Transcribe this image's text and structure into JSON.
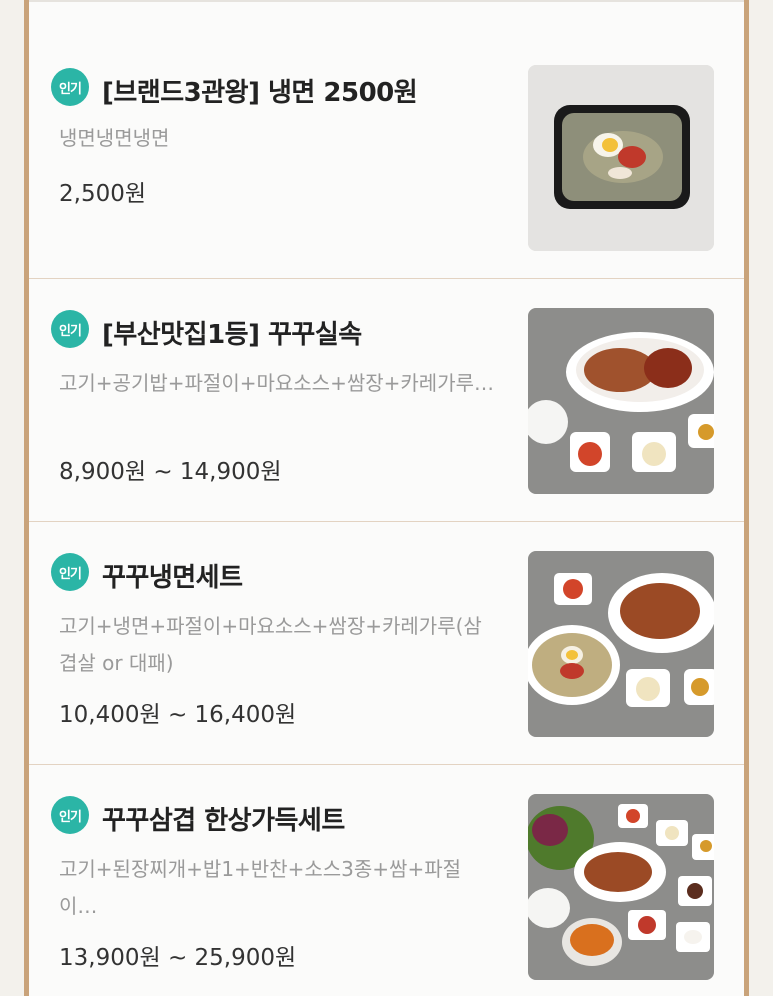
{
  "menu_items": [
    {
      "badge": "인기",
      "name": "[브랜드3관왕] 냉면 2500원",
      "description": "냉면냉면냉면",
      "price": "2,500원",
      "image_icon": "naengmyeon-tray-photo"
    },
    {
      "badge": "인기",
      "name": "[부산맛집1등] 꾸꾸실속",
      "description": "고기+공기밥+파절이+마요소스+쌈장+카레가루…",
      "price": "8,900원 ~ 14,900원",
      "image_icon": "pork-plate-set-photo"
    },
    {
      "badge": "인기",
      "name": "꾸꾸냉면세트",
      "description": "고기+냉면+파절이+마요소스+쌈장+카레가루(삼겹살 or 대패)",
      "price": "10,400원 ~ 16,400원",
      "image_icon": "naengmyeon-set-photo"
    },
    {
      "badge": "인기",
      "name": "꾸꾸삼겹 한상가득세트",
      "description": "고기+된장찌개+밥1+반찬+소스3종+쌈+파절이…",
      "price": "13,900원 ~ 25,900원",
      "image_icon": "full-table-set-photo"
    }
  ],
  "colors": {
    "badge": "#2bb5a6",
    "rail": "#c9a37a",
    "divider": "#e3d3c2"
  }
}
